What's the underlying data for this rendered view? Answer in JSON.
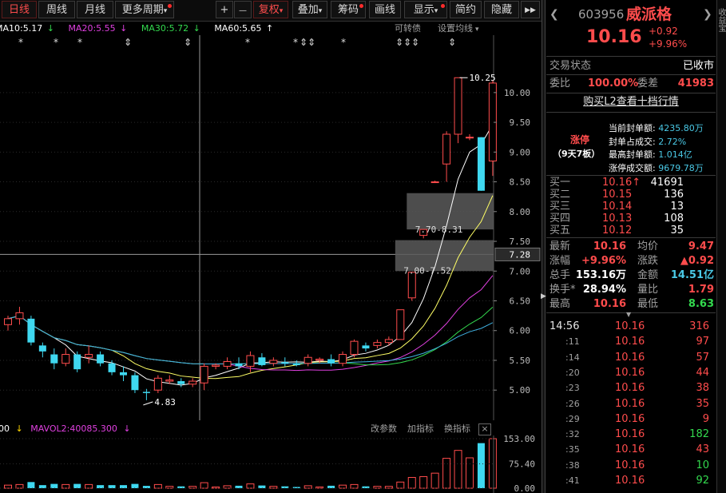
{
  "toolbar": {
    "tabs": [
      "日线",
      "周线",
      "月线",
      "更多周期"
    ],
    "zoom_in": "+",
    "zoom_out": "—",
    "buttons": [
      "复权",
      "叠加",
      "筹码",
      "画线",
      "显示",
      "简约",
      "隐藏"
    ],
    "dropdown_glyph": "▾",
    "more_glyph": "▶▶"
  },
  "ma_legend": [
    {
      "label": "MA10:5.17",
      "arrow": "↓",
      "color": "#ffffff"
    },
    {
      "label": "MA20:5.55",
      "arrow": "↓",
      "color": "#e040e0"
    },
    {
      "label": "MA30:5.72",
      "arrow": "↓",
      "color": "#33d94e"
    },
    {
      "label": "MA60:5.65",
      "arrow": "↑",
      "color": "#ffffff"
    }
  ],
  "chart_header": {
    "convertible": "可转债",
    "setting": "设置均线"
  },
  "stock": {
    "code": "603956",
    "name": "威派格",
    "price": "10.16",
    "change": "+0.92",
    "change_pct": "+9.96%"
  },
  "chart_data": {
    "type": "candlestick",
    "y_ticks": [
      "10.00",
      "9.50",
      "9.00",
      "8.50",
      "8.00",
      "7.50",
      "7.00",
      "6.50",
      "6.00",
      "5.50",
      "5.00"
    ],
    "y_range": [
      4.6,
      10.75
    ],
    "crosshair_price": "7.28",
    "annotations": {
      "high": "10.25",
      "low": "4.83",
      "gap_upper": "7.70-8.31",
      "gap_lower": "7.00-7.52"
    },
    "candles": [
      [
        6.1,
        6.2,
        6.0,
        6.25
      ],
      [
        6.2,
        6.3,
        6.1,
        6.4
      ],
      [
        6.2,
        5.8,
        5.75,
        6.25
      ],
      [
        5.75,
        5.65,
        5.55,
        5.8
      ],
      [
        5.6,
        5.45,
        5.35,
        5.7
      ],
      [
        5.45,
        5.6,
        5.4,
        5.7
      ],
      [
        5.6,
        5.35,
        5.3,
        5.65
      ],
      [
        5.55,
        5.6,
        5.45,
        5.75
      ],
      [
        5.6,
        5.45,
        5.4,
        5.65
      ],
      [
        5.45,
        5.3,
        5.25,
        5.5
      ],
      [
        5.3,
        5.25,
        5.15,
        5.4
      ],
      [
        5.25,
        5.0,
        4.95,
        5.3
      ],
      [
        4.97,
        4.95,
        4.83,
        5.02
      ],
      [
        5.0,
        5.2,
        4.95,
        5.25
      ],
      [
        5.15,
        5.17,
        5.1,
        5.25
      ],
      [
        5.15,
        5.1,
        5.05,
        5.2
      ],
      [
        5.1,
        5.15,
        5.05,
        5.2
      ],
      [
        5.12,
        5.4,
        5.0,
        5.45
      ],
      [
        5.4,
        5.42,
        5.35,
        5.45
      ],
      [
        5.4,
        5.48,
        5.35,
        5.55
      ],
      [
        5.45,
        5.4,
        5.35,
        5.55
      ],
      [
        5.4,
        5.58,
        5.3,
        5.65
      ],
      [
        5.55,
        5.42,
        5.4,
        5.62
      ],
      [
        5.45,
        5.5,
        5.4,
        5.55
      ],
      [
        5.47,
        5.45,
        5.4,
        5.55
      ],
      [
        5.45,
        5.42,
        5.4,
        5.5
      ],
      [
        5.45,
        5.55,
        5.4,
        5.6
      ],
      [
        5.5,
        5.52,
        5.45,
        5.55
      ],
      [
        5.52,
        5.45,
        5.4,
        5.6
      ],
      [
        5.45,
        5.6,
        5.4,
        5.65
      ],
      [
        5.6,
        5.82,
        5.55,
        5.85
      ],
      [
        5.75,
        5.7,
        5.65,
        5.8
      ],
      [
        5.75,
        5.8,
        5.7,
        5.85
      ],
      [
        5.8,
        5.85,
        5.75,
        5.9
      ],
      [
        5.85,
        6.35,
        5.85,
        6.35
      ],
      [
        6.55,
        6.98,
        6.5,
        6.98
      ],
      [
        7.6,
        7.7,
        7.55,
        7.7
      ],
      [
        8.5,
        8.5,
        8.48,
        8.52
      ],
      [
        8.8,
        9.3,
        8.5,
        9.35
      ],
      [
        9.3,
        10.25,
        9.15,
        10.25
      ],
      [
        9.25,
        9.25,
        9.2,
        9.3
      ],
      [
        9.25,
        8.35,
        8.35,
        9.25
      ],
      [
        8.85,
        10.16,
        8.6,
        10.2
      ]
    ],
    "star_markers": [
      "*",
      "*",
      "*",
      "⇕",
      "⇕",
      "*",
      "*",
      "⇕⇕",
      "*",
      "⇕⇕",
      "⇕",
      "⇕"
    ],
    "volume": {
      "label": "MAVOL2:40085.300",
      "arrow": "↓",
      "prefix_arrow": "↓",
      "prefix": "00",
      "y_ticks": [
        "153.00",
        "75.40",
        "0.00"
      ],
      "tools": [
        "改参数",
        "加指标",
        "换指标"
      ],
      "close_glyph": "×"
    }
  },
  "orderbook": {
    "status_label": "交易状态",
    "status_value": "已收市",
    "ratio_label": "委比",
    "ratio_value": "100.00%",
    "diff_label": "委差",
    "diff_value": "41983",
    "l2_link": "购买L2查看十档行情",
    "limit_title": "涨停",
    "limit_sub": "（9天7板）",
    "limit_stats": [
      {
        "label": "当前封单额:",
        "value": "4235.80万"
      },
      {
        "label": "封单占成交:",
        "value": "2.72%"
      },
      {
        "label": "最高封单额:",
        "value": "1.014亿"
      },
      {
        "label": "涨停成交额:",
        "value": "9679.78万"
      }
    ],
    "bids": [
      {
        "label": "买一",
        "price": "10.16↑",
        "vol": "41691"
      },
      {
        "label": "买二",
        "price": "10.15",
        "vol": "136"
      },
      {
        "label": "买三",
        "price": "10.14",
        "vol": "13"
      },
      {
        "label": "买四",
        "price": "10.13",
        "vol": "108"
      },
      {
        "label": "买五",
        "price": "10.12",
        "vol": "35"
      }
    ]
  },
  "quote_stats": [
    {
      "l1": "最新",
      "v1": "10.16",
      "l2": "均价",
      "v2": "9.47"
    },
    {
      "l1": "涨幅",
      "v1": "+9.96%",
      "l2": "涨跌",
      "v2": "▲0.92"
    },
    {
      "l1": "总手",
      "v1": "153.16万",
      "l2": "金额",
      "v2": "14.51亿"
    },
    {
      "l1": "换手*",
      "v1": "28.94%",
      "l2": "量比",
      "v2": "1.79"
    },
    {
      "l1": "最高",
      "v1": "10.16",
      "l2": "最低",
      "v2": "8.63"
    }
  ],
  "trades": [
    {
      "time": "14:56",
      "price": "10.16",
      "vol": "316"
    },
    {
      "time": ":11",
      "price": "10.16",
      "vol": "97"
    },
    {
      "time": ":14",
      "price": "10.16",
      "vol": "57"
    },
    {
      "time": ":20",
      "price": "10.16",
      "vol": "44"
    },
    {
      "time": ":23",
      "price": "10.16",
      "vol": "38"
    },
    {
      "time": ":26",
      "price": "10.16",
      "vol": "35"
    },
    {
      "time": ":29",
      "price": "10.16",
      "vol": "9"
    },
    {
      "time": ":32",
      "price": "10.16",
      "vol": "182"
    },
    {
      "time": ":35",
      "price": "10.16",
      "vol": "43"
    },
    {
      "time": ":38",
      "price": "10.16",
      "vol": "10"
    },
    {
      "time": ":41",
      "price": "10.16",
      "vol": "92"
    }
  ],
  "side_strip_text": "收益宝",
  "colors": {
    "up": "#ff4c4c",
    "down": "#3fd8f0",
    "green": "#33d94e",
    "bg": "#000000"
  }
}
